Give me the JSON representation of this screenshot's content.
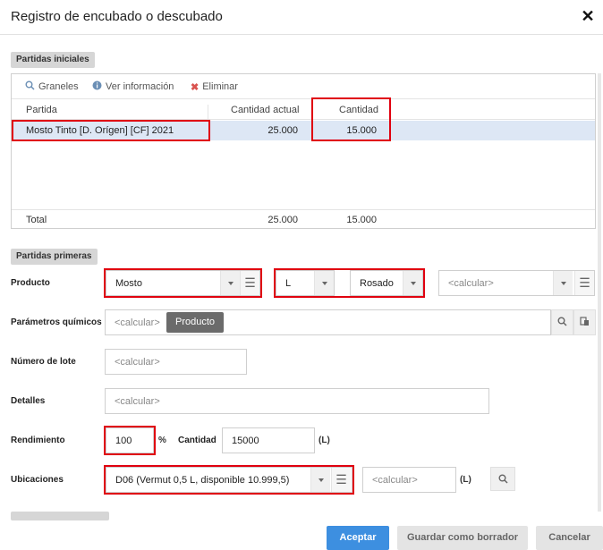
{
  "dialog": {
    "title": "Registro de encubado o descubado",
    "close_symbol": "✕"
  },
  "initial_section": {
    "chip": "Partidas iniciales",
    "toolbar": {
      "granel_icon": "search-icon",
      "granel": "Graneles",
      "info_icon": "info-icon",
      "info": "Ver información",
      "delete_icon": "delete-icon",
      "delete": "Eliminar"
    },
    "columns": [
      "Partida",
      "Cantidad actual",
      "Cantidad"
    ],
    "rows": [
      {
        "partida": "Mosto Tinto [D. Orígen] [CF] 2021",
        "actual": "25.000",
        "cantidad": "15.000"
      }
    ],
    "total": {
      "label": "Total",
      "actual": "25.000",
      "cantidad": "15.000"
    }
  },
  "first_section": {
    "chip": "Partidas primeras",
    "producto": {
      "label": "Producto",
      "value": "Mosto",
      "unit": "L",
      "color": "Rosado",
      "extra_placeholder": "<calcular>"
    },
    "parametros": {
      "label": "Parámetros químicos",
      "placeholder": "<calcular>",
      "tag": "Producto"
    },
    "lote": {
      "label": "Número de lote",
      "placeholder": "<calcular>"
    },
    "detalles": {
      "label": "Detalles",
      "placeholder": "<calcular>"
    },
    "rendimiento": {
      "label": "Rendimiento",
      "value": "100",
      "percent": "%",
      "cantidad_label": "Cantidad",
      "cantidad_value": "15000",
      "unit": "(L)"
    },
    "ubicaciones": {
      "label": "Ubicaciones",
      "value": "D06 (Vermut 0,5 L, disponible 10.999,5)",
      "placeholder": "<calcular>",
      "unit": "(L)"
    }
  },
  "footer": {
    "accept": "Aceptar",
    "draft": "Guardar como borrador",
    "cancel": "Cancelar"
  },
  "colors": {
    "highlight_border": "#e0000f",
    "selected_row": "#dde7f5",
    "primary_button": "#3d8fe0"
  }
}
